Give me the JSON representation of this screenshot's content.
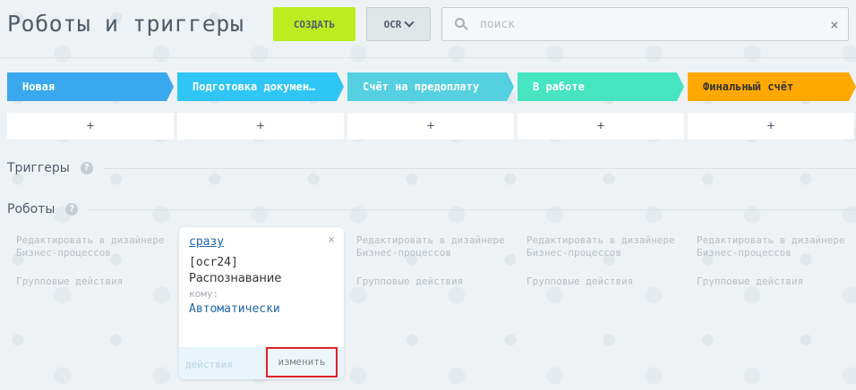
{
  "header": {
    "title": "Роботы и триггеры",
    "create_label": "СОЗДАТЬ",
    "filter_label": "OCR",
    "search_placeholder": "поиск",
    "clear_symbol": "×"
  },
  "stages": [
    {
      "label": "Новая",
      "color": "#39a8ef"
    },
    {
      "label": "Подготовка докумен…",
      "color": "#2fc6f6"
    },
    {
      "label": "Счёт на предоплату",
      "color": "#55d0e0"
    },
    {
      "label": "В работе",
      "color": "#47e4c2"
    },
    {
      "label": "Финальный счёт",
      "color": "#ffa900"
    }
  ],
  "add_symbol": "+",
  "sections": {
    "triggers": "Триггеры",
    "robots": "Роботы",
    "help_symbol": "?"
  },
  "column_links": {
    "edit_in_designer": "Редактировать в дизайнере Бизнес-процессов",
    "group_actions": "Групповые действия"
  },
  "robot": {
    "when": "сразу",
    "close_symbol": "×",
    "provider": "[ocr24]",
    "name": "Распознавание",
    "to_label": "кому:",
    "to_value": "Автоматически",
    "actions_label": "действия",
    "edit_label": "изменить"
  }
}
